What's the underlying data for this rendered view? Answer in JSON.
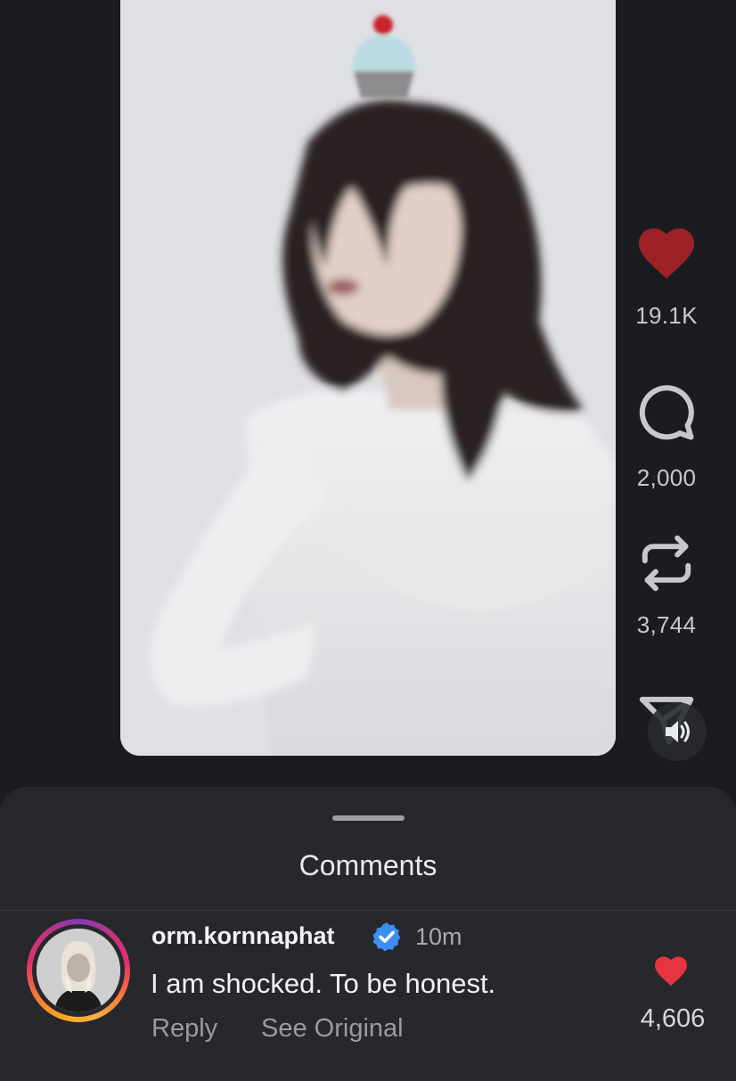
{
  "post": {
    "actions": {
      "like": {
        "icon": "heart-icon",
        "count": "19.1K",
        "color": "#b0282c"
      },
      "comment": {
        "icon": "speech-bubble-icon",
        "count": "2,000"
      },
      "repost": {
        "icon": "repost-icon",
        "count": "3,744"
      },
      "share": {
        "icon": "paper-plane-icon"
      }
    },
    "sound": {
      "icon": "speaker-icon"
    }
  },
  "comments_sheet": {
    "title": "Comments",
    "comments": [
      {
        "username": "orm.kornnaphat",
        "verified": true,
        "time": "10m",
        "text": "I am shocked. To be honest.",
        "reply_label": "Reply",
        "see_original_label": "See Original",
        "like_count": "4,606",
        "like_color": "#e8343f"
      }
    ]
  }
}
